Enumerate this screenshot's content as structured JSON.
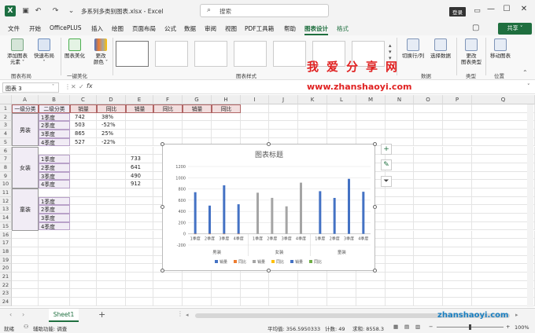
{
  "window": {
    "doc_title": "多系列多类别图表.xlsx  -  Excel",
    "search_placeholder": "搜索",
    "login_label": "登录",
    "minimize": "—",
    "restore": "☐",
    "close": "✕"
  },
  "menu": {
    "tabs": [
      "文件",
      "开始",
      "OfficePLUS",
      "插入",
      "绘图",
      "页面布局",
      "公式",
      "数据",
      "审阅",
      "视图",
      "PDF工具箱",
      "帮助",
      "图表设计",
      "格式"
    ],
    "active_tab": "图表设计",
    "share_label": "共享"
  },
  "ribbon": {
    "add_element": "添加图表\n元素 ˅",
    "quick_layout": "快速布局\n˅",
    "beautify": "图表美化",
    "change_color": "更改\n颜色 ˅",
    "switch_row_col": "切换行/列",
    "select_data": "选择数据",
    "change_type": "更改\n图表类型",
    "move_chart": "移动图表",
    "groups": {
      "layout": "图表布局",
      "beautify": "一键美化",
      "styles": "图表样式",
      "data": "数据",
      "type": "类型",
      "location": "位置"
    }
  },
  "formula_bar": {
    "name_box": "图表 3",
    "fx": "fx"
  },
  "watermark": {
    "title": "我爱分享网",
    "url": "www.zhanshaoyi.com",
    "bottom": "zhanshaoyi.com"
  },
  "sheet": {
    "columns": [
      "A",
      "B",
      "C",
      "D",
      "E",
      "F",
      "G",
      "H",
      "I",
      "J",
      "K",
      "L",
      "M",
      "N",
      "O",
      "P",
      "Q"
    ],
    "rows": [
      "1",
      "2",
      "3",
      "4",
      "5",
      "6",
      "7",
      "8",
      "9",
      "10",
      "11",
      "12",
      "13",
      "14",
      "15",
      "16",
      "17",
      "18",
      "19",
      "20",
      "21",
      "22",
      "23",
      "24"
    ],
    "header_row": [
      "一级分类",
      "二级分类",
      "销量",
      "同比",
      "销量",
      "同比",
      "销量",
      "同比"
    ],
    "groups": [
      "男装",
      "女装",
      "童装"
    ],
    "quarters": [
      "1季度",
      "2季度",
      "3季度",
      "4季度"
    ],
    "men_sales": [
      "742",
      "503",
      "865",
      "527"
    ],
    "men_yoy": [
      "38%",
      "-52%",
      "25%",
      "-22%"
    ],
    "women_sales": [
      "733",
      "641",
      "490",
      "912"
    ]
  },
  "chart_data": {
    "type": "bar",
    "title": "图表标题",
    "ylim": [
      -200,
      1200
    ],
    "yticks": [
      "1200",
      "1000",
      "800",
      "600",
      "400",
      "200",
      "0",
      "-200"
    ],
    "categories": [
      "1季度",
      "2季度",
      "3季度",
      "4季度",
      "1季度",
      "2季度",
      "3季度",
      "4季度",
      "1季度",
      "2季度",
      "3季度",
      "4季度"
    ],
    "groups": [
      "男装",
      "女装",
      "童装"
    ],
    "series": [
      {
        "name": "销量",
        "color": "#4472c4",
        "values": [
          742,
          503,
          865,
          527,
          null,
          null,
          null,
          null,
          null,
          null,
          null,
          null
        ]
      },
      {
        "name": "同比",
        "color": "#ed7d31",
        "values": [
          0.38,
          -0.52,
          0.25,
          -0.22,
          null,
          null,
          null,
          null,
          null,
          null,
          null,
          null
        ]
      },
      {
        "name": "销量",
        "color": "#a5a5a5",
        "values": [
          null,
          null,
          null,
          null,
          733,
          641,
          490,
          912,
          null,
          null,
          null,
          null
        ]
      },
      {
        "name": "同比",
        "color": "#ffc000",
        "values": [
          null,
          null,
          null,
          null,
          null,
          null,
          null,
          null,
          null,
          null,
          null,
          null
        ]
      },
      {
        "name": "销量",
        "color": "#4472c4",
        "values": [
          null,
          null,
          null,
          null,
          null,
          null,
          null,
          null,
          760,
          640,
          980,
          750
        ]
      },
      {
        "name": "同比",
        "color": "#70ad47",
        "values": [
          null,
          null,
          null,
          null,
          null,
          null,
          null,
          null,
          null,
          null,
          null,
          null
        ]
      }
    ],
    "legend": "bottom"
  },
  "sheetbar": {
    "tab": "Sheet1",
    "add": "+"
  },
  "status": {
    "ready": "就绪",
    "accessibility": "辅助功能: 调查",
    "average": "平均值: 356.5950333",
    "count": "计数: 49",
    "sum": "求和: 8558.3",
    "zoom": "100%"
  }
}
